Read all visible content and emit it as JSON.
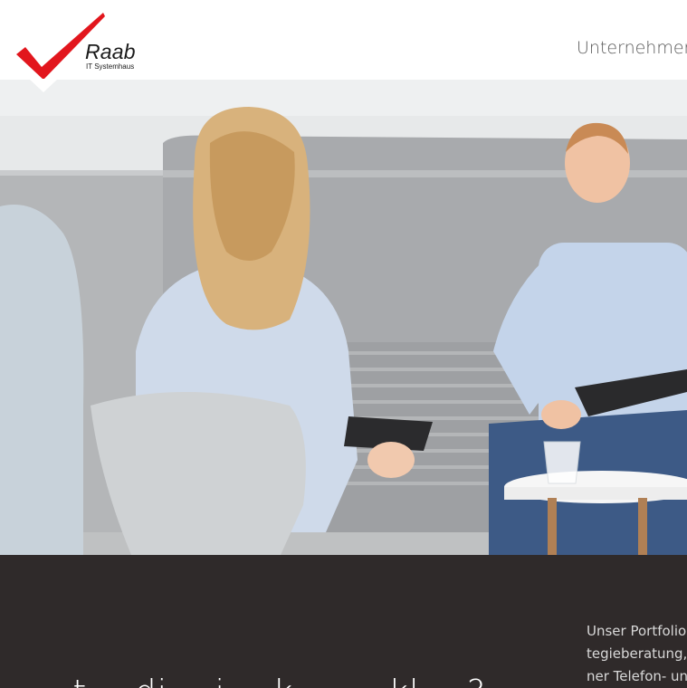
{
  "header": {
    "logo": {
      "name": "Raab",
      "subtitle": "IT Systemhaus",
      "brand_color": "#e2161d"
    },
    "nav": {
      "item_1": "Unternehmen"
    }
  },
  "hero": {
    "image_description": "photo-two-people-meeting-on-sofa"
  },
  "section": {
    "background_color": "#2f2a2a",
    "heading_partial": "... t... di... i... k... ... kl... ?",
    "portfolio_lines": [
      "Unser Portfolio",
      "tegieberatung, (",
      "ner Telefon- und"
    ]
  }
}
